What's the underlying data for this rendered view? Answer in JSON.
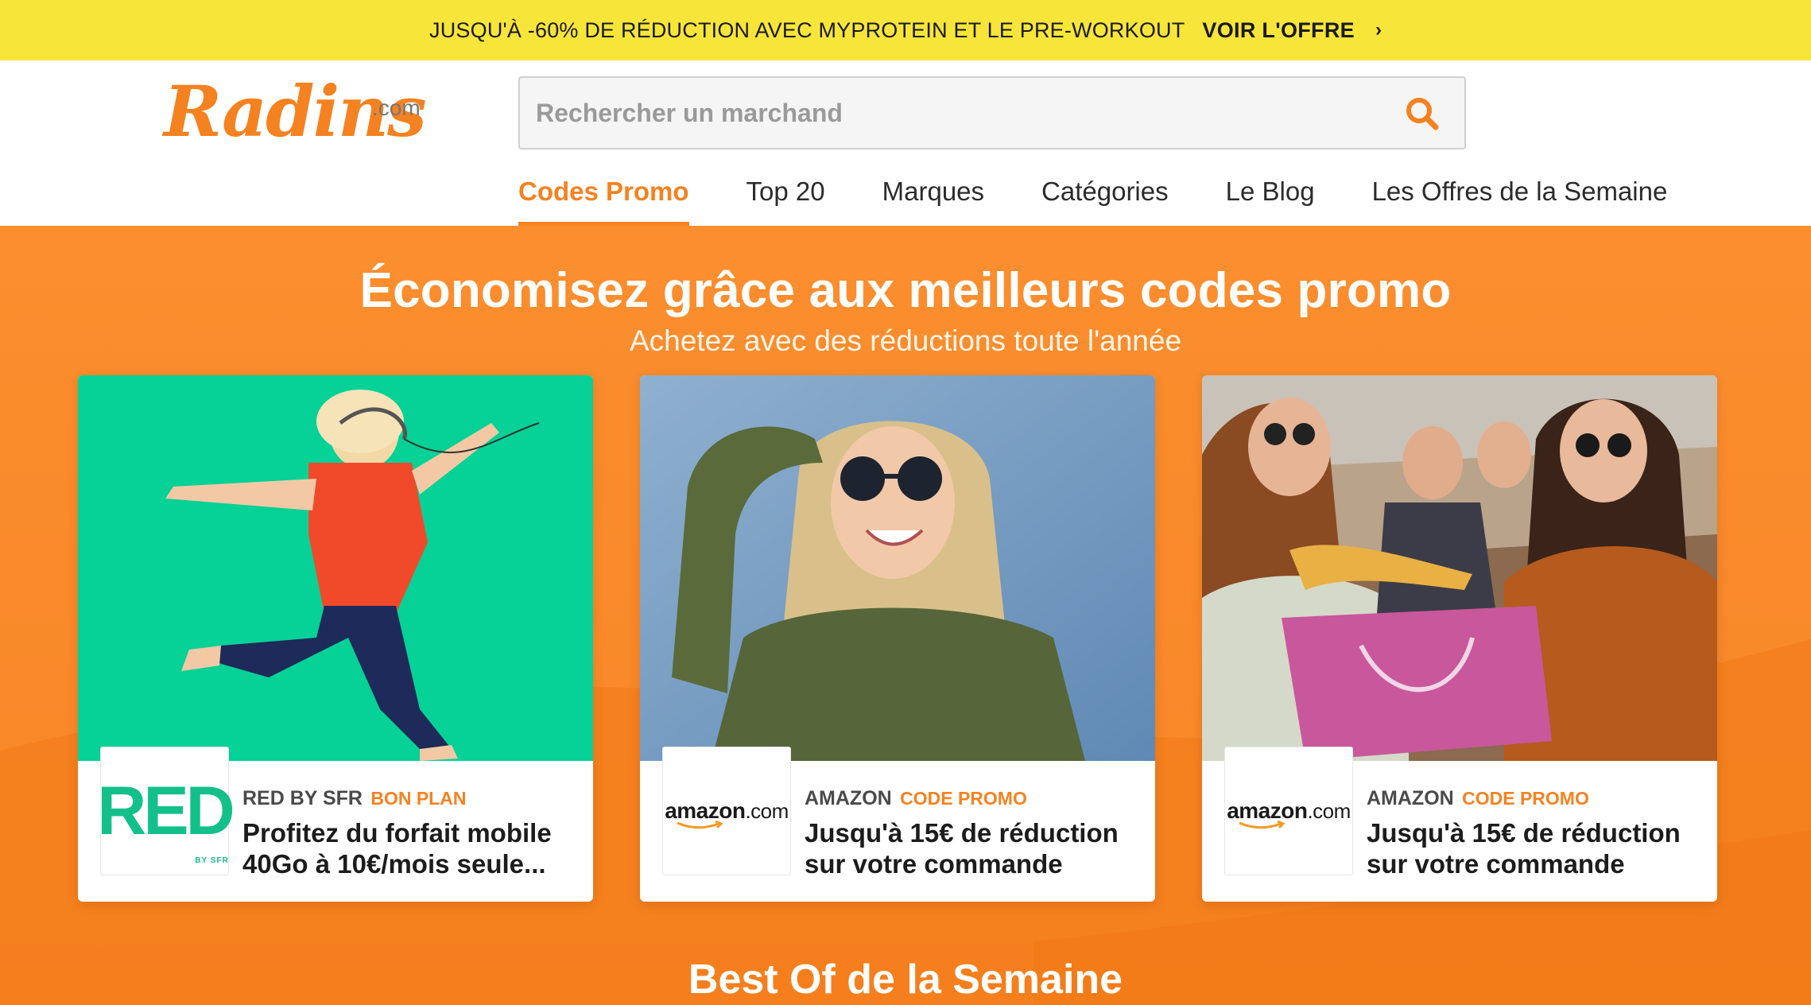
{
  "topbar": {
    "message": "JUSQU'À -60% DE RÉDUCTION AVEC MYPROTEIN ET LE PRE-WORKOUT",
    "cta": "VOIR L'OFFRE",
    "chevron": "›"
  },
  "header": {
    "logo_text": "Radins",
    "logo_suffix": ".com",
    "search_placeholder": "Rechercher un marchand",
    "search_icon": "search-icon"
  },
  "nav": {
    "items": [
      {
        "label": "Codes Promo",
        "active": true
      },
      {
        "label": "Top 20"
      },
      {
        "label": "Marques"
      },
      {
        "label": "Catégories"
      },
      {
        "label": "Le Blog"
      },
      {
        "label": "Les Offres de la Semaine"
      }
    ]
  },
  "hero": {
    "title": "Économisez grâce aux meilleurs codes promo",
    "subtitle": "Achetez avec des réductions toute l'année"
  },
  "cards": [
    {
      "merchant": "RED BY SFR",
      "type": "BON PLAN",
      "description": "Profitez du forfait mobile 40Go à 10€/mois seule...",
      "logo_text": "RED",
      "logo_small": "BY SFR",
      "image": "woman-jumping-green-background"
    },
    {
      "merchant": "AMAZON",
      "type": "CODE PROMO",
      "description": "Jusqu'à 15€ de réduction sur votre commande",
      "logo_text": "amazon",
      "logo_suffix": ".com",
      "image": "woman-smiling-sunglasses"
    },
    {
      "merchant": "AMAZON",
      "type": "CODE PROMO",
      "description": "Jusqu'à 15€ de réduction sur votre commande",
      "logo_text": "amazon",
      "logo_suffix": ".com",
      "image": "friends-shopping-car"
    }
  ],
  "section": {
    "title": "Best Of de la Semaine"
  },
  "colors": {
    "accent": "#f58220",
    "banner": "#f8e53a",
    "red_brand": "#14c08a"
  }
}
